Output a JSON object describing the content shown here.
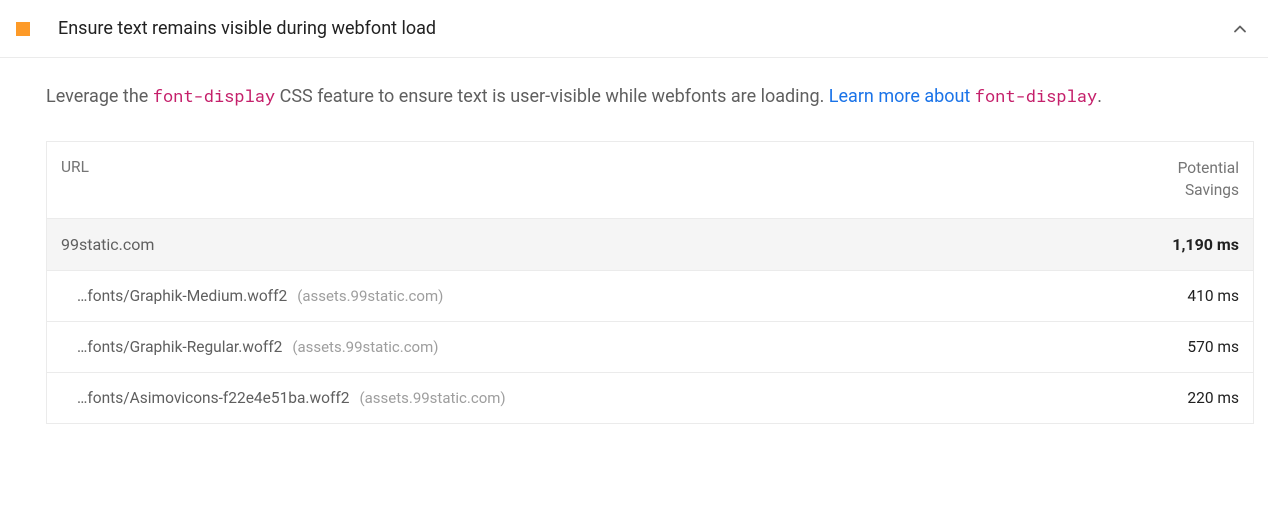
{
  "audit": {
    "title": "Ensure text remains visible during webfont load",
    "description": {
      "lead": "Leverage the ",
      "code1": "font-display",
      "mid": " CSS feature to ensure text is user-visible while webfonts are loading. ",
      "link_lead": "Learn more about ",
      "code2": "font-display",
      "trail": "."
    },
    "table": {
      "col_url": "URL",
      "col_savings": "Potential Savings",
      "group": {
        "name": "99static.com",
        "total": "1,190 ms"
      },
      "items": [
        {
          "path": "…fonts/Graphik-Medium.woff2",
          "origin": "(assets.99static.com)",
          "savings": "410 ms"
        },
        {
          "path": "…fonts/Graphik-Regular.woff2",
          "origin": "(assets.99static.com)",
          "savings": "570 ms"
        },
        {
          "path": "…fonts/Asimovicons-f22e4e51ba.woff2",
          "origin": "(assets.99static.com)",
          "savings": "220 ms"
        }
      ]
    }
  }
}
